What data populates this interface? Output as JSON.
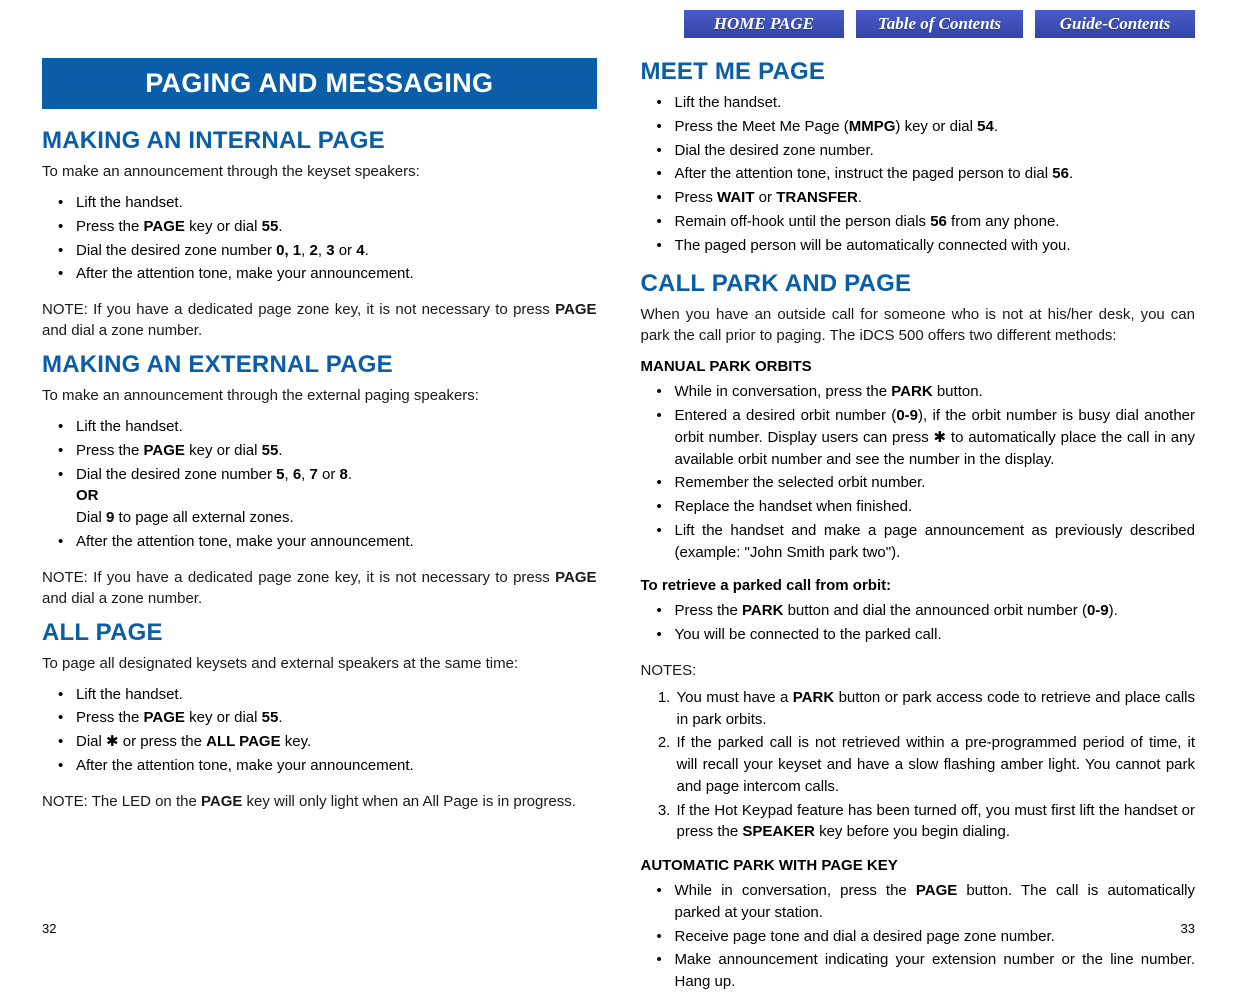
{
  "nav": {
    "home": "HOME PAGE",
    "toc": "Table of Contents",
    "guide": "Guide-Contents"
  },
  "left": {
    "banner": "PAGING AND MESSAGING",
    "s1": {
      "heading": "MAKING AN INTERNAL PAGE",
      "intro": "To make an announcement through the keyset speakers:",
      "li1": "Lift the handset.",
      "li2a": "Press the ",
      "li2b": "PAGE",
      "li2c": " key or dial ",
      "li2d": "55",
      "li2e": ".",
      "li3a": "Dial the desired zone number ",
      "li3b": "0, 1",
      "li3c": ", ",
      "li3d": "2",
      "li3e": ", ",
      "li3f": "3",
      "li3g": " or ",
      "li3h": "4",
      "li3i": ".",
      "li4": "After the attention tone, make your announcement.",
      "notea": "NOTE: If you have a dedicated page zone key, it is not necessary to press ",
      "noteb": "PAGE",
      "notec": " and dial a zone number."
    },
    "s2": {
      "heading": "MAKING AN EXTERNAL PAGE",
      "intro": "To make an announcement through the external paging speakers:",
      "li1": "Lift the handset.",
      "li2a": "Press the ",
      "li2b": "PAGE",
      "li2c": " key or dial ",
      "li2d": "55",
      "li2e": ".",
      "li3a": "Dial the desired zone number ",
      "li3b": "5",
      "li3c": ", ",
      "li3d": "6",
      "li3e": ", ",
      "li3f": "7",
      "li3g": " or ",
      "li3h": "8",
      "li3i": ".",
      "orlabel": "OR",
      "ora": "Dial ",
      "orb": "9",
      "orc": " to page all external zones.",
      "li4": "After the attention tone, make your announcement.",
      "notea": "NOTE: If you have a dedicated page zone key, it is not necessary to press ",
      "noteb": "PAGE",
      "notec": " and dial a zone number."
    },
    "s3": {
      "heading": "ALL PAGE",
      "intro": "To page all designated keysets and external speakers at the same time:",
      "li1": "Lift the handset.",
      "li2a": "Press the ",
      "li2b": "PAGE",
      "li2c": " key or dial ",
      "li2d": "55",
      "li2e": ".",
      "li3a": "Dial ✱ or press the ",
      "li3b": "ALL PAGE",
      "li3c": " key.",
      "li4": "After the attention tone, make your announcement.",
      "notea": "NOTE: The LED on the ",
      "noteb": "PAGE",
      "notec": " key will only light when an All Page is in progress."
    }
  },
  "right": {
    "s1": {
      "heading": "MEET ME PAGE",
      "li1": "Lift the handset.",
      "li2a": "Press the Meet Me Page (",
      "li2b": "MMPG",
      "li2c": ") key or dial ",
      "li2d": "54",
      "li2e": ".",
      "li3": "Dial the desired zone number.",
      "li4a": "After the attention tone, instruct the paged person to dial ",
      "li4b": "56",
      "li4c": ".",
      "li5a": "Press ",
      "li5b": "WAIT",
      "li5c": " or ",
      "li5d": "TRANSFER",
      "li5e": ".",
      "li6a": "Remain off-hook until the person dials ",
      "li6b": "56",
      "li6c": " from any phone.",
      "li7": "The paged person will be automatically connected with you."
    },
    "s2": {
      "heading": "CALL PARK AND PAGE",
      "intro": "When you have an outside call for someone who is not at his/her desk, you can park the call prior to paging. The iDCS 500 offers two different methods:",
      "sub1": "MANUAL PARK ORBITS",
      "m1a": "While in conversation, press the ",
      "m1b": "PARK",
      "m1c": " button.",
      "m2a": "Entered a desired orbit number (",
      "m2b": "0-9",
      "m2c": "), if the orbit number is busy dial another orbit number. Display users can press ✱ to automatically place the call in any available orbit number and see the number in the display.",
      "m3": "Remember the selected orbit number.",
      "m4": "Replace the handset when finished.",
      "m5": "Lift the handset and make a page announcement as previously described (example: \"John Smith park two\").",
      "retr": "To retrieve a parked call from orbit:",
      "r1a": "Press the ",
      "r1b": "PARK",
      "r1c": " button and dial the announced orbit number (",
      "r1d": "0-9",
      "r1e": ").",
      "r2": "You will be connected to the parked call.",
      "noteslabel": "NOTES:",
      "n1a": "You must have a ",
      "n1b": "PARK",
      "n1c": " button or park access code to retrieve and place calls in park orbits.",
      "n2": "If the parked call is not retrieved within a pre-programmed period of time, it will recall your keyset and have a slow flashing amber light. You cannot park and page intercom calls.",
      "n3a": "If the Hot Keypad feature has been turned off, you must first lift the handset or press the ",
      "n3b": "SPEAKER",
      "n3c": " key before you begin dialing.",
      "sub2": "AUTOMATIC PARK WITH PAGE KEY",
      "a1a": "While in conversation, press the ",
      "a1b": "PAGE",
      "a1c": " button. The call is automatically parked at your station.",
      "a2": "Receive page tone and dial a desired page zone number.",
      "a3": "Make announcement indicating your extension number or the line number. Hang up."
    }
  },
  "pages": {
    "left": "32",
    "right": "33"
  }
}
